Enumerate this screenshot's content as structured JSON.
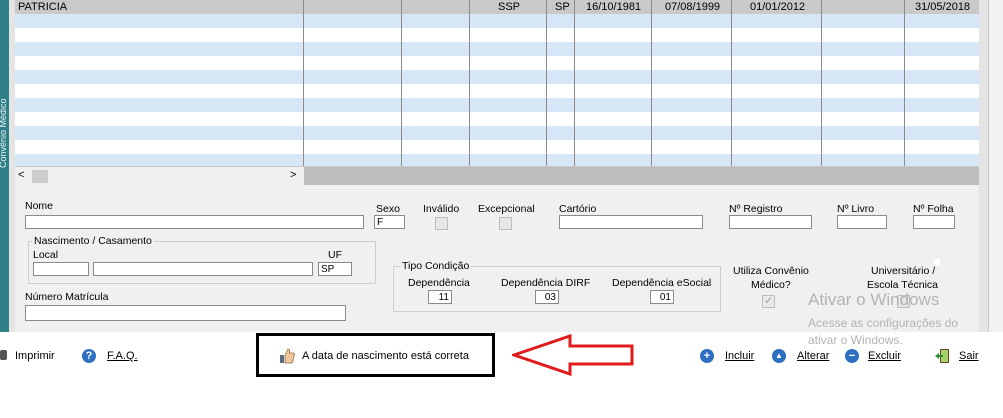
{
  "left_tab": {
    "label": "Convênio Médico"
  },
  "grid": {
    "first_row": {
      "name": "PATRICIA",
      "org": "SSP",
      "uf": "SP",
      "date1": "16/10/1981",
      "date2": "07/08/1999",
      "date3": "01/01/2012",
      "date4": "31/05/2018"
    }
  },
  "scroll": {
    "left_arrow": "<",
    "right_arrow": ">"
  },
  "form": {
    "nome_label": "Nome",
    "sexo_label": "Sexo",
    "sexo_value": "F",
    "invalido_label": "Inválido",
    "excepcional_label": "Excepcional",
    "cartorio_label": "Cartório",
    "registro_label": "Nº Registro",
    "livro_label": "Nº Livro",
    "folha_label": "Nº Folha",
    "nascimento_group": "Nascimento / Casamento",
    "local_label": "Local",
    "uf_label": "UF",
    "uf_value": "SP",
    "matricula_label": "Número Matrícula",
    "tipo_condicao_group": "Tipo Condição",
    "dependencia_label": "Dependência",
    "dependencia_value": "11",
    "dirf_label": "Dependência DIRF",
    "dirf_value": "03",
    "esocial_label": "Dependência eSocial",
    "esocial_value": "01",
    "convenio_label_1": "Utiliza Convênio",
    "convenio_label_2": "Médico?",
    "universitario_label_1": "Universitário /",
    "universitario_label_2": "Escola Técnica"
  },
  "watermark": {
    "line1": "Ativar o Windows",
    "line2": "Acesse as configurações do",
    "line3": "ativar o Windows."
  },
  "bottom": {
    "imprimir": "Imprimir",
    "faq": "F.A.Q.",
    "message": "A data de nascimento está correta",
    "incluir": "Incluir",
    "alterar": "Alterar",
    "excluir": "Excluir",
    "sair": "Sair"
  },
  "colors": {
    "accent_arrow": "#e01b1b",
    "teal_tab": "#2e7f86",
    "row_blue": "#d7e7f7"
  }
}
